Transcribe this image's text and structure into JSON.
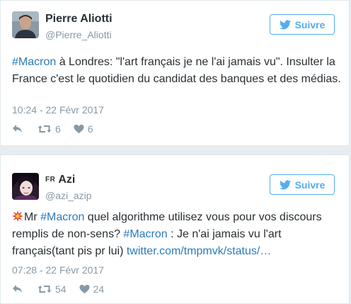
{
  "colors": {
    "background": "#e6ecf0",
    "card": "#ffffff",
    "text": "#292f33",
    "muted": "#8899a6",
    "link": "#2b7bb9",
    "accent": "#55acee"
  },
  "tweets": [
    {
      "display_name": "Pierre Aliotti",
      "flag_text": "",
      "handle": "@Pierre_Aliotti",
      "follow_label": "Suivre",
      "text": {
        "hashtag1": "#Macron",
        "part1": " à Londres: \"l'art français je ne l'ai jamais vu\". Insulter la France c'est le quotidien du candidat des banques et des médias."
      },
      "timestamp": "10:24 - 22 Févr 2017",
      "retweets": "6",
      "likes": "6"
    },
    {
      "display_name": "Azi",
      "flag_text": "FR",
      "handle": "@azi_azip",
      "follow_label": "Suivre",
      "text": {
        "emoji": "collision-emoji",
        "part1": "Mr ",
        "hashtag1": "#Macron",
        "part2": " quel algorithme utilisez vous pour vos discours remplis de non-sens? ",
        "hashtag2": "#Macron",
        "part3": " : Je n'ai jamais vu l'art français(tant pis pr lui) ",
        "link": "twitter.com/tmpmvk/status/…"
      },
      "timestamp": "07:28 - 22 Févr 2017",
      "retweets": "54",
      "likes": "24"
    }
  ]
}
